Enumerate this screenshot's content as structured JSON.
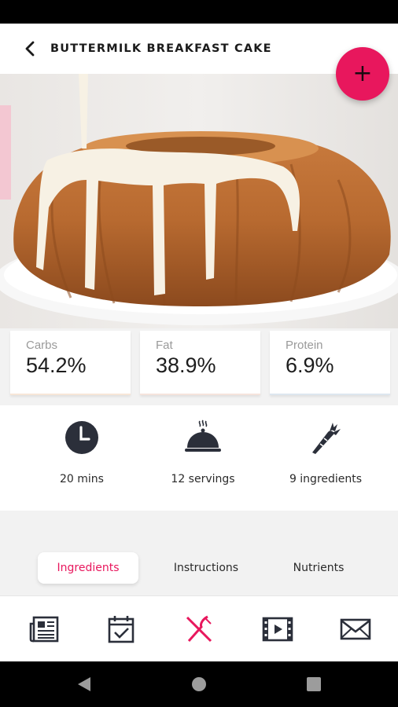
{
  "header": {
    "title": "BUTTERMILK BREAKFAST CAKE",
    "back_icon": "back-arrow-icon"
  },
  "fab": {
    "label": "+",
    "color": "#e8175d"
  },
  "macros": [
    {
      "label": "Carbs",
      "value": "54.2%"
    },
    {
      "label": "Fat",
      "value": "38.9%"
    },
    {
      "label": "Protein",
      "value": "6.9%"
    }
  ],
  "stats": [
    {
      "label": "20 mins",
      "icon": "clock-icon"
    },
    {
      "label": "12 servings",
      "icon": "cloche-icon"
    },
    {
      "label": "9 ingredients",
      "icon": "carrot-icon"
    }
  ],
  "tabs": [
    {
      "label": "Ingredients",
      "active": true
    },
    {
      "label": "Instructions",
      "active": false
    },
    {
      "label": "Nutrients",
      "active": false
    }
  ],
  "bottom_nav": [
    {
      "icon": "newspaper-icon"
    },
    {
      "icon": "calendar-check-icon"
    },
    {
      "icon": "fork-knife-icon",
      "active": true
    },
    {
      "icon": "video-icon"
    },
    {
      "icon": "mail-icon"
    }
  ],
  "colors": {
    "accent": "#e8175d",
    "text": "#1d1d1d",
    "muted": "#9a9a9a"
  }
}
